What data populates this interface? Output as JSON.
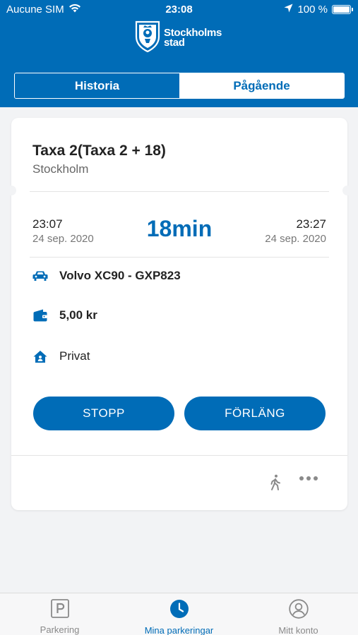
{
  "status_bar": {
    "carrier": "Aucune SIM",
    "time": "23:08",
    "battery": "100 %"
  },
  "logo": {
    "line1": "Stockholms",
    "line2": "stad"
  },
  "tabs": {
    "history": "Historia",
    "ongoing": "Pågående"
  },
  "parking": {
    "zone": "Taxa 2(Taxa 2 + 18)",
    "city": "Stockholm",
    "start_time": "23:07",
    "start_date": "24 sep. 2020",
    "duration": "18min",
    "end_time": "23:27",
    "end_date": "24 sep. 2020",
    "vehicle": "Volvo XC90 - GXP823",
    "cost": "5,00 kr",
    "account_type": "Privat"
  },
  "buttons": {
    "stop": "STOPP",
    "extend": "FÖRLÄNG"
  },
  "tabbar": {
    "parking": "Parkering",
    "my_parkings": "Mina parkeringar",
    "my_account": "Mitt konto"
  },
  "colors": {
    "brand": "#006cb7",
    "background": "#f2f3f5"
  }
}
